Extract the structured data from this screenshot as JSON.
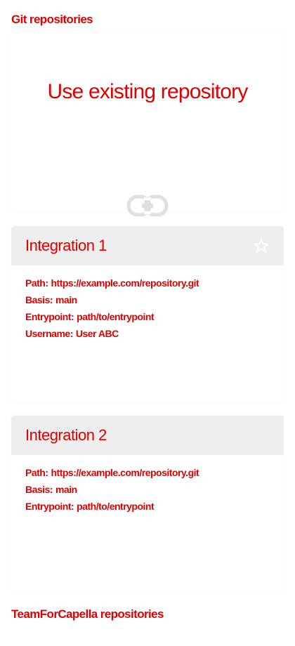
{
  "git_section": {
    "title": "Git repositories"
  },
  "use_existing": {
    "title": "Use existing repository",
    "icon": "link-icon"
  },
  "integrations": [
    {
      "name": "Integration 1",
      "favorite_icon": "star-outline-icon",
      "path_label": "Path:",
      "path": "https://example.com/repository.git",
      "basis_label": "Basis:",
      "basis": "main",
      "entrypoint_label": "Entrypoint:",
      "entrypoint": "path/to/entrypoint",
      "username_label": "Username:",
      "username": "User ABC"
    },
    {
      "name": "Integration 2",
      "path_label": "Path:",
      "path": "https://example.com/repository.git",
      "basis_label": "Basis:",
      "basis": "main",
      "entrypoint_label": "Entrypoint:",
      "entrypoint": "path/to/entrypoint"
    }
  ],
  "teamforcapella_section": {
    "title": "TeamForCapella repositories"
  },
  "colors": {
    "text": "#e00000",
    "header_background": "#eeeeee",
    "icon": "#e0e0e0"
  }
}
